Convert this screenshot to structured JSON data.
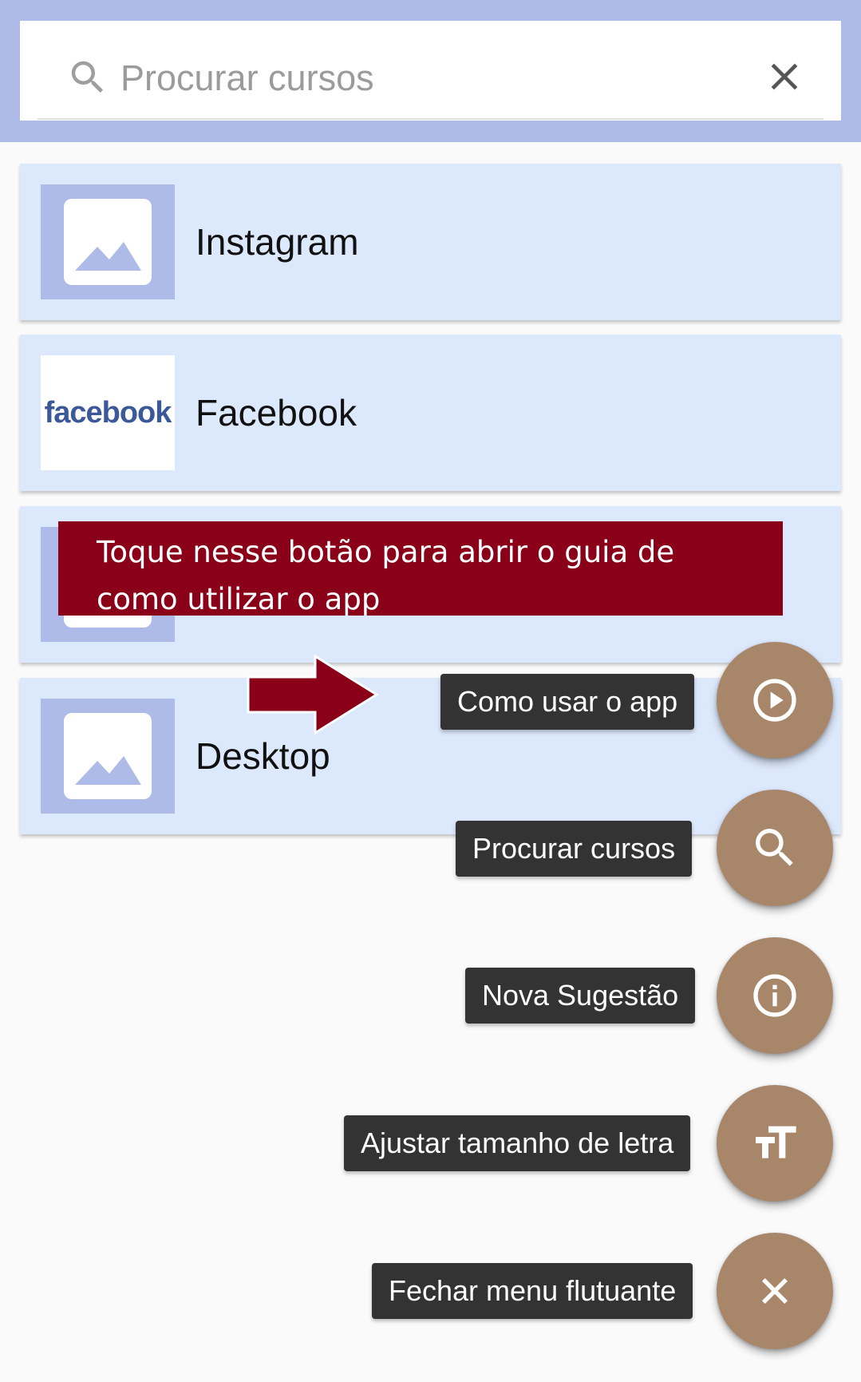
{
  "search": {
    "placeholder": "Procurar cursos",
    "icon": "search-icon",
    "clear_icon": "close-icon"
  },
  "courses": [
    {
      "title": "Instagram",
      "thumbnail": "image-placeholder-icon"
    },
    {
      "title": "Facebook",
      "thumbnail_text": "facebook"
    },
    {
      "title": "",
      "thumbnail": "image-placeholder-icon"
    },
    {
      "title": "Desktop",
      "thumbnail": "image-placeholder-icon"
    }
  ],
  "callout": {
    "line1": "Toque nesse botão para abrir o guia de",
    "line2": "como utilizar o app"
  },
  "fab_menu": [
    {
      "label": "Como usar o app",
      "icon": "play-circle-icon"
    },
    {
      "label": "Procurar cursos",
      "icon": "search-icon"
    },
    {
      "label": "Nova Sugestão",
      "icon": "info-icon"
    },
    {
      "label": "Ajustar tamanho de letra",
      "icon": "text-size-icon"
    },
    {
      "label": "Fechar menu flutuante",
      "icon": "close-icon"
    }
  ],
  "colors": {
    "header": "#aebbe8",
    "card": "#dce8fb",
    "fab": "#a8866a",
    "callout": "#8a0018",
    "chip": "#333333",
    "facebook_brand": "#3b5998"
  }
}
